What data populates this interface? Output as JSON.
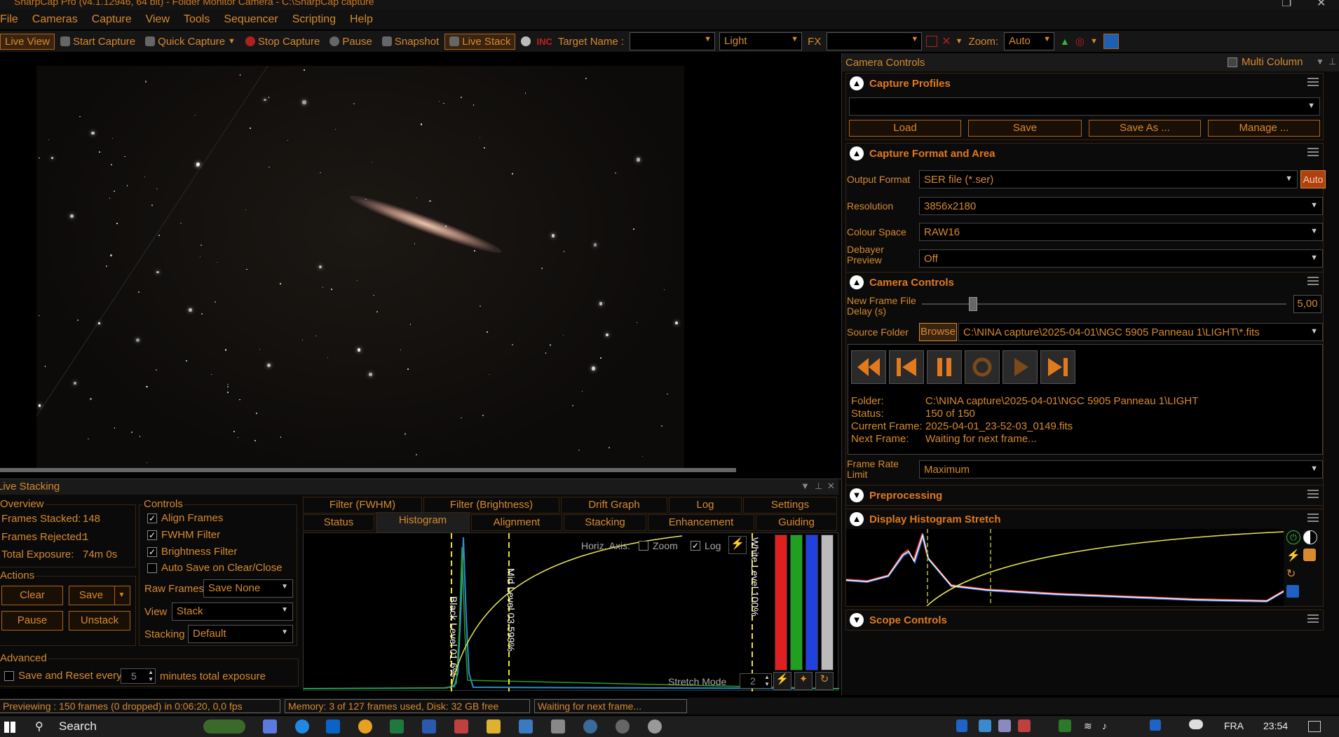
{
  "window": {
    "title": "SharpCap Pro (v4.1.12946, 64 bit) - Folder Monitor Camera - C:\\SharpCap capture"
  },
  "menu": [
    "File",
    "Cameras",
    "Capture",
    "View",
    "Tools",
    "Sequencer",
    "Scripting",
    "Help"
  ],
  "toolbar": {
    "live_view": "Live View",
    "start_capture": "Start Capture",
    "quick_capture": "Quick Capture",
    "stop_capture": "Stop Capture",
    "pause": "Pause",
    "snapshot": "Snapshot",
    "live_stack": "Live Stack",
    "target_name_label": "Target Name :",
    "target_name_value": "",
    "frame_type": "Light",
    "fx_label": "FX",
    "fx_value": "",
    "zoom_label": "Zoom:",
    "zoom_value": "Auto"
  },
  "live_stacking": {
    "title": "Live Stacking",
    "overview": {
      "title": "Overview",
      "frames_stacked_label": "Frames Stacked:",
      "frames_stacked": "148",
      "frames_rejected_label": "Frames Rejected:",
      "frames_rejected": "1",
      "total_exposure_label": "Total Exposure:",
      "total_exposure": "74m 0s"
    },
    "actions": {
      "title": "Actions",
      "clear": "Clear",
      "save": "Save",
      "pause": "Pause",
      "unstack": "Unstack"
    },
    "controls": {
      "title": "Controls",
      "align_frames": "Align Frames",
      "fwhm_filter": "FWHM Filter",
      "brightness_filter": "Brightness Filter",
      "auto_save": "Auto Save on Clear/Close",
      "raw_frames_label": "Raw Frames",
      "raw_frames_value": "Save None",
      "view_label": "View",
      "view_value": "Stack",
      "stacking_label": "Stacking",
      "stacking_value": "Default"
    },
    "advanced": {
      "title": "Advanced",
      "save_reset_label": "Save and Reset every",
      "save_reset_value": "5",
      "save_reset_suffix": "minutes total exposure"
    },
    "tabs_top": [
      "Filter (FWHM)",
      "Filter (Brightness)",
      "Drift Graph",
      "Log",
      "Settings"
    ],
    "tabs_bottom": [
      "Status",
      "Histogram",
      "Alignment",
      "Stacking",
      "Enhancement",
      "Guiding"
    ],
    "histogram": {
      "horiz_axis_label": "Horiz. Axis:",
      "zoom_label": "Zoom",
      "log_label": "Log",
      "black_level": "Black Level  01.6%",
      "mid_level": "Mid Level  03.599%",
      "white_level": "White Level  100%",
      "stretch_mode_label": "Stretch Mode",
      "stretch_mode_value": "2"
    }
  },
  "camera_controls": {
    "title": "Camera Controls",
    "multi_column": "Multi Column",
    "capture_profiles": {
      "title": "Capture Profiles",
      "profile_value": "",
      "load": "Load",
      "save": "Save",
      "save_as": "Save As ...",
      "manage": "Manage ..."
    },
    "capture_format": {
      "title": "Capture Format and Area",
      "output_format_label": "Output Format",
      "output_format": "SER file (*.ser)",
      "auto": "Auto",
      "resolution_label": "Resolution",
      "resolution": "3856x2180",
      "colour_space_label": "Colour Space",
      "colour_space": "RAW16",
      "debayer_label_1": "Debayer",
      "debayer_label_2": "Preview",
      "debayer": "Off"
    },
    "camera_controls_section": {
      "title": "Camera Controls",
      "new_frame_label_1": "New Frame File",
      "new_frame_label_2": "Delay (s)",
      "new_frame_delay": "5,00",
      "new_frame_delay_fraction": 0.14,
      "source_folder_label": "Source Folder",
      "browse": "Browse",
      "source_folder": "C:\\NINA capture\\2025-04-01\\NGC 5905 Panneau 1\\LIGHT\\*.fits",
      "folder_label": "Folder:",
      "folder": "C:\\NINA capture\\2025-04-01\\NGC 5905 Panneau 1\\LIGHT",
      "status_label": "Status:",
      "status": "150 of 150",
      "current_frame_label": "Current Frame:",
      "current_frame": "2025-04-01_23-52-03_0149.fits",
      "next_frame_label": "Next Frame:",
      "next_frame": "Waiting for next frame...",
      "frame_rate_label_1": "Frame Rate",
      "frame_rate_label_2": "Limit",
      "frame_rate": "Maximum"
    },
    "preprocessing": {
      "title": "Preprocessing"
    },
    "display_histogram": {
      "title": "Display Histogram Stretch"
    },
    "scope_controls": {
      "title": "Scope Controls"
    }
  },
  "status_bar": {
    "previewing": "Previewing : 150 frames (0 dropped) in 0:06:20, 0,0 fps",
    "memory": "Memory: 3 of 127 frames used, Disk: 32 GB free",
    "waiting": "Waiting for next frame..."
  },
  "taskbar": {
    "search": "Search",
    "language": "FRA",
    "time": "23:54"
  },
  "colors": {
    "accent": "#d88a2e",
    "border": "#3a2410",
    "background": "#0a0a0a"
  }
}
